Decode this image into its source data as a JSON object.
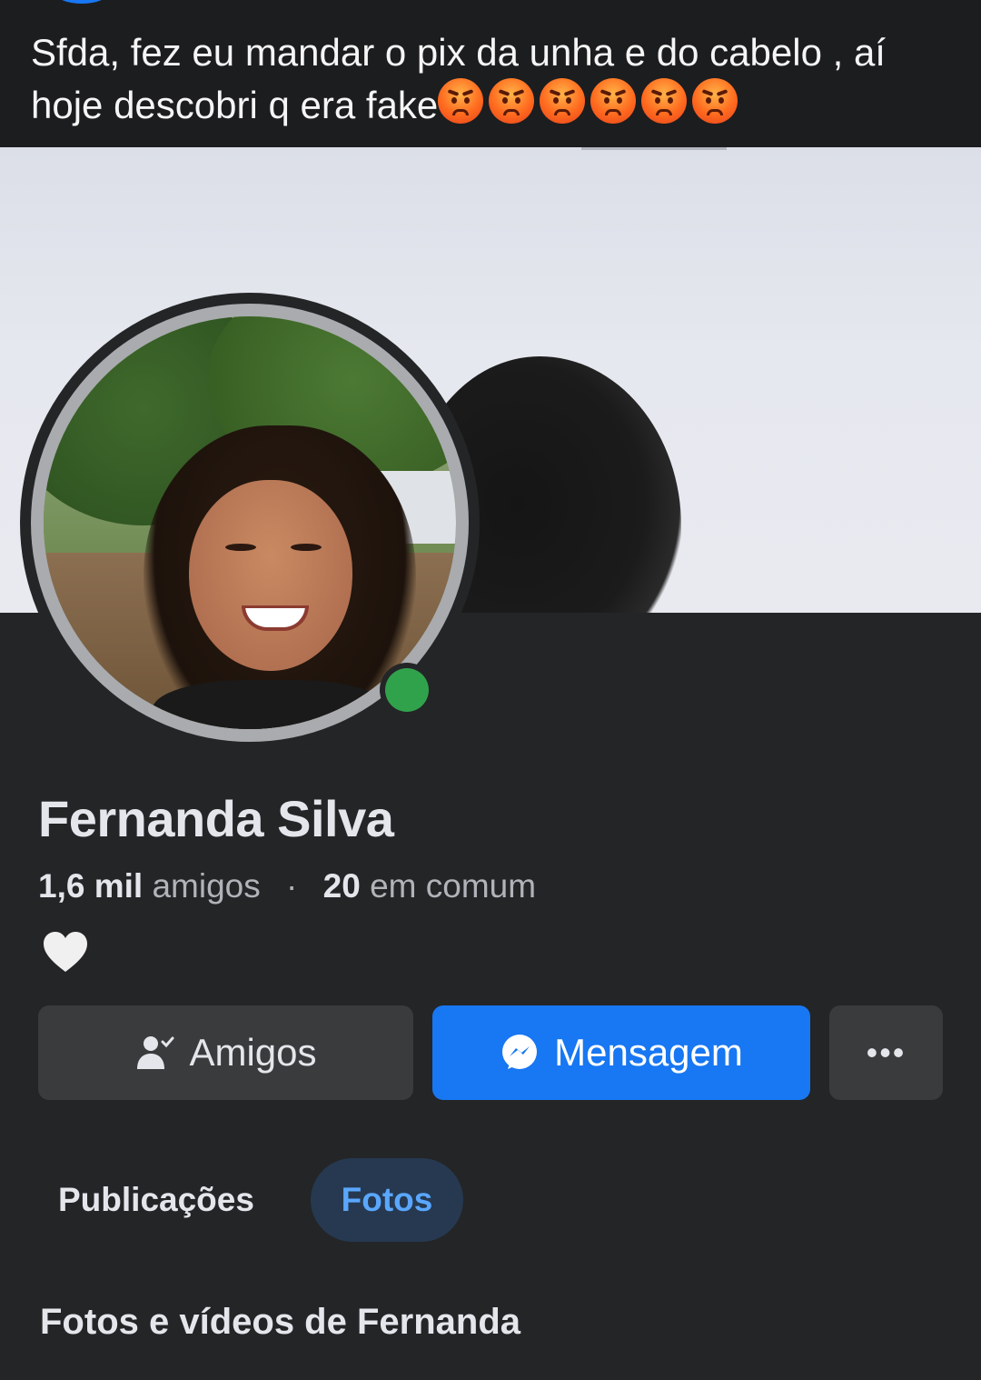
{
  "caption": {
    "text": "Sfda, fez eu mandar o pix da unha e do cabelo , aí hoje descobri q era fake",
    "emojis": [
      "angry-face",
      "angry-face",
      "angry-face",
      "angry-face",
      "angry-face",
      "angry-face"
    ]
  },
  "profile": {
    "name": "Fernanda Silva",
    "friends_count": "1,6 mil",
    "friends_label": "amigos",
    "mutual_count": "20",
    "mutual_label": "em comum",
    "online": true,
    "bio_icon": "white-heart"
  },
  "buttons": {
    "friends_label": "Amigos",
    "message_label": "Mensagem",
    "more_label": "•••"
  },
  "tabs": [
    {
      "label": "Publicações",
      "active": false
    },
    {
      "label": "Fotos",
      "active": true
    }
  ],
  "section": {
    "title": "Fotos e vídeos de Fernanda"
  },
  "colors": {
    "background": "#242527",
    "primary_button": "#1877f2",
    "secondary_button": "#3a3b3c",
    "active_tab_bg": "#263951",
    "active_tab_text": "#5aa7ff",
    "online": "#31a24c"
  }
}
